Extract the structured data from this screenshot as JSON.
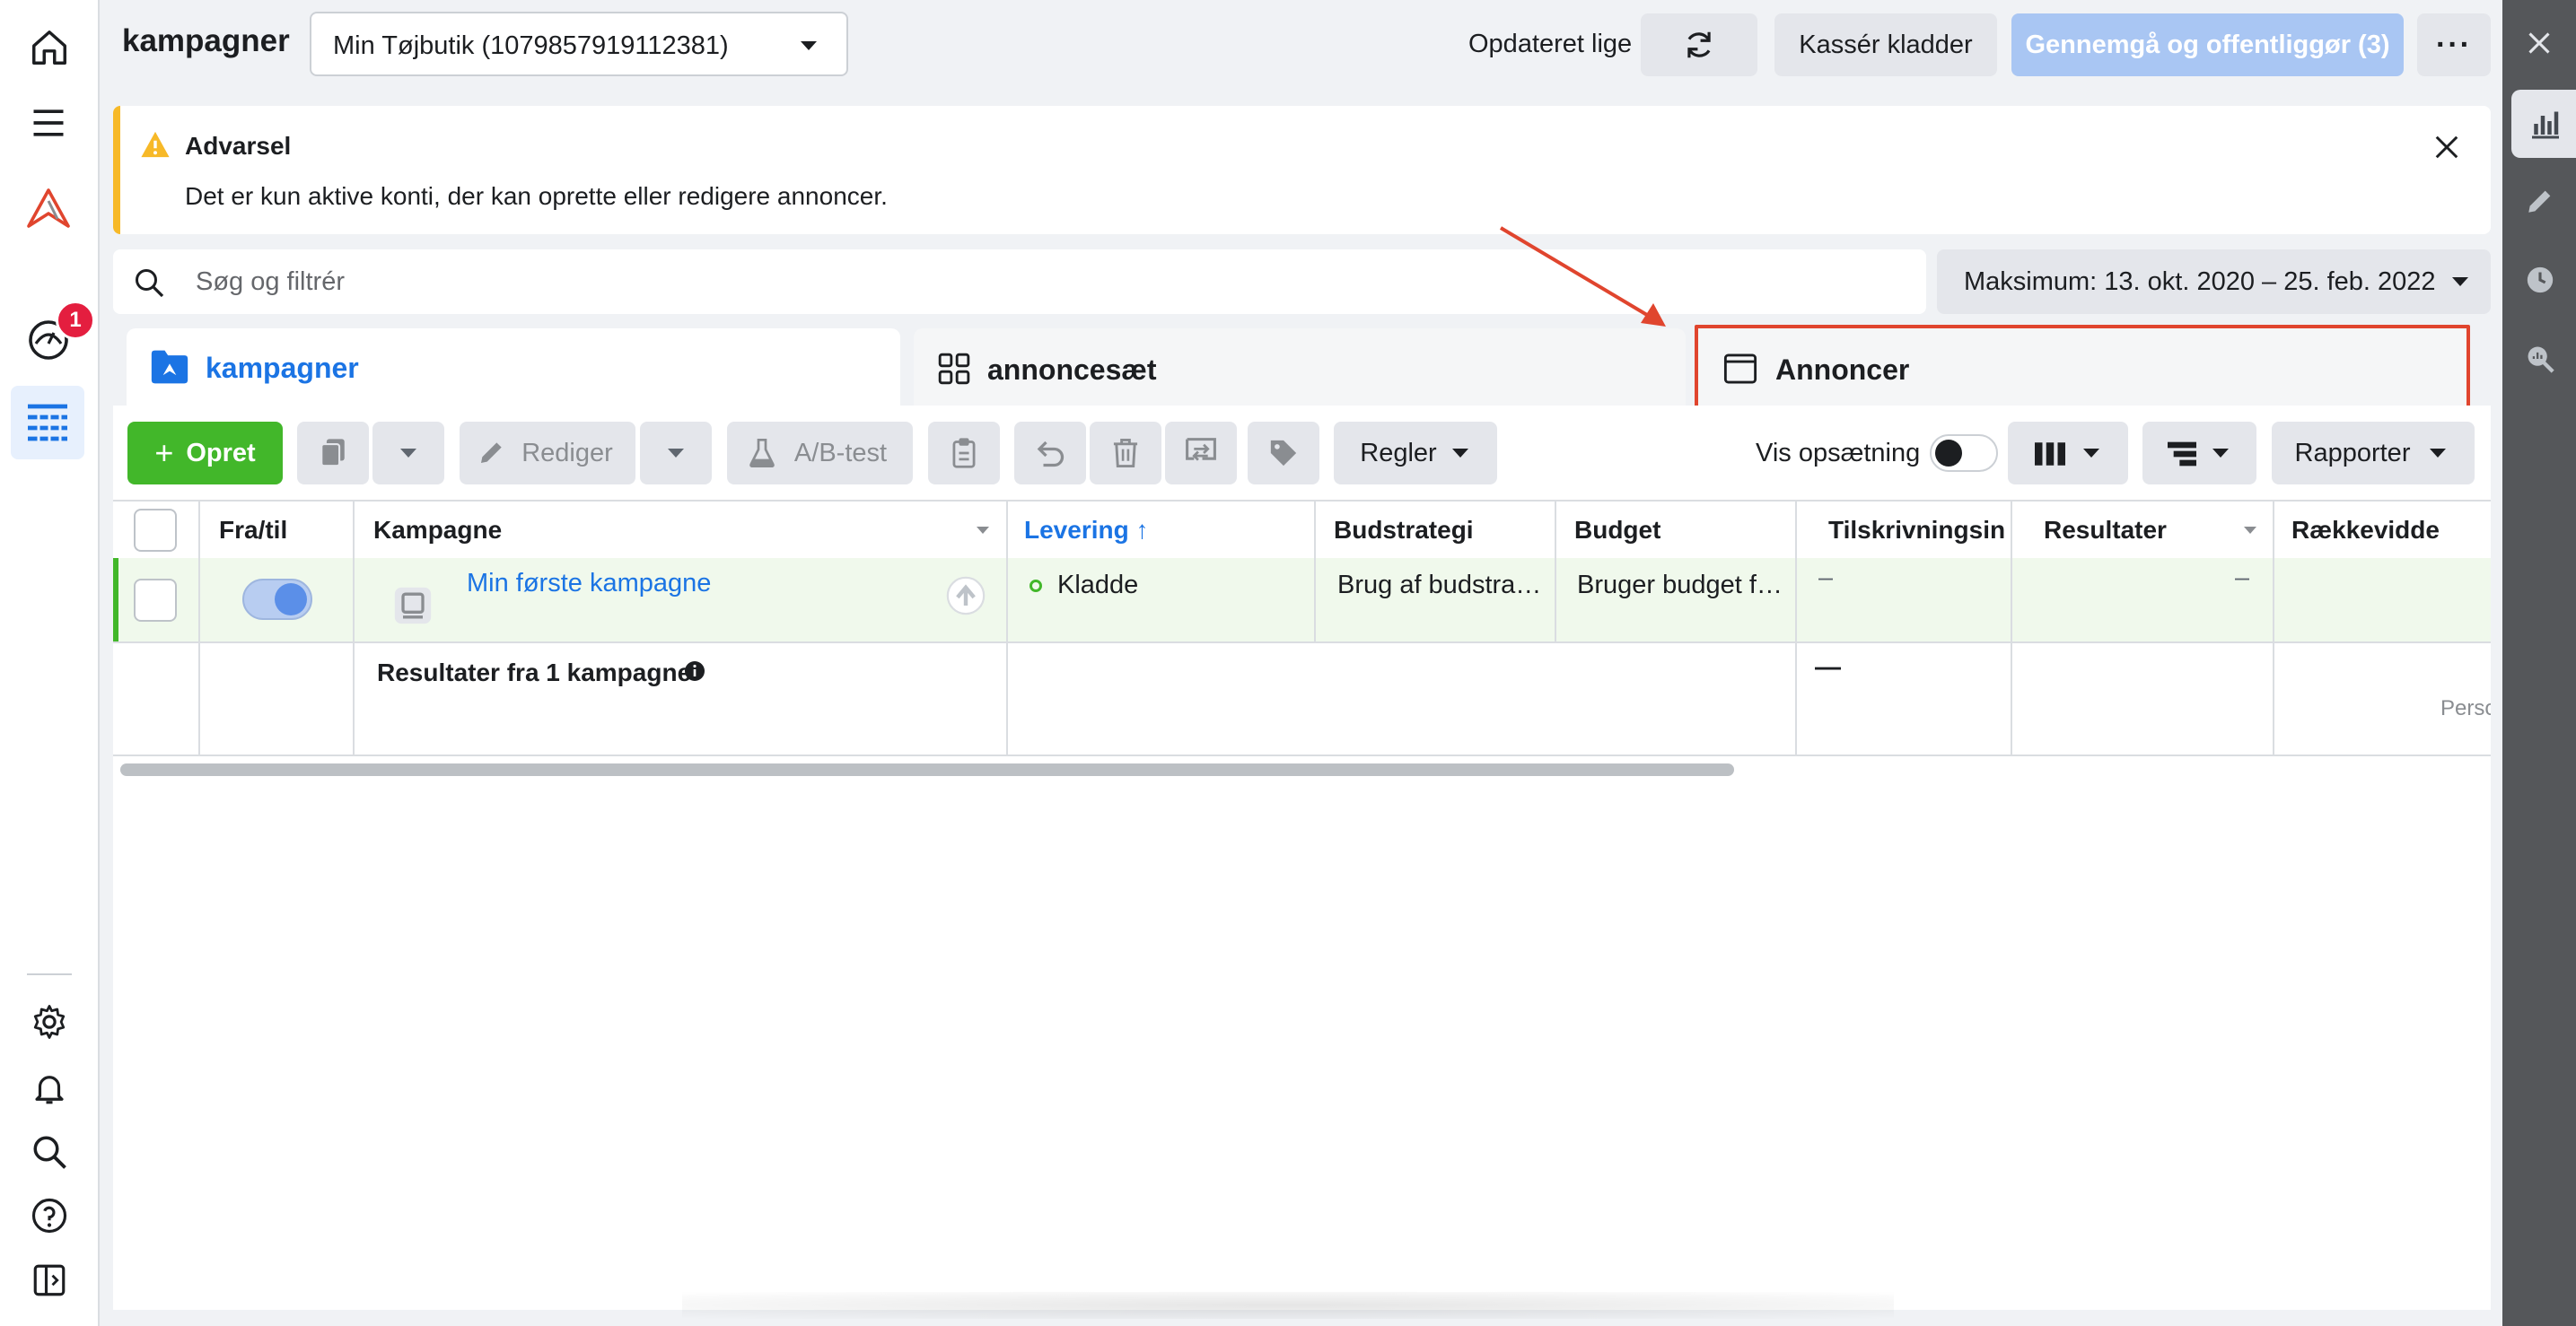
{
  "leftnav": {
    "notification_count": "1"
  },
  "header": {
    "title": "kampagner",
    "account": "Min Tøjbutik (1079857919112381)",
    "updated": "Opdateret lige nu",
    "discard": "Kassér kladder",
    "publish": "Gennemgå og offentliggør (3)"
  },
  "warning": {
    "title": "Advarsel",
    "text": "Det er kun aktive konti, der kan oprette eller redigere annoncer."
  },
  "search": {
    "placeholder": "Søg og filtrér"
  },
  "date_range": "Maksimum: 13. okt. 2020 – 25. feb. 2022",
  "tabs": [
    {
      "label": "kampagner"
    },
    {
      "label": "annoncesæt"
    },
    {
      "label": "Annoncer"
    }
  ],
  "toolbar": {
    "create": "Opret",
    "edit": "Rediger",
    "ab_test": "A/B-test",
    "rules": "Regler",
    "view_setup": "Vis opsætning",
    "reports": "Rapporter"
  },
  "table": {
    "headers": [
      "Fra/til",
      "Kampagne",
      "Levering",
      "Budstrategi",
      "Budget",
      "Tilskrivningsindstilling",
      "Resultater",
      "Rækkevidde"
    ],
    "sort_indicator": "↑",
    "rows": [
      {
        "campaign": "Min første kampagne",
        "delivery": "Kladde",
        "bid_strategy": "Brug af budstra…",
        "budget": "Bruger budget f…",
        "attribution": "–",
        "results": "–",
        "toggle_on": true
      }
    ],
    "summary": {
      "label": "Resultater fra 1 kampagne",
      "attribution": "—",
      "reach_note": "Perso"
    }
  },
  "colors": {
    "accent": "#1b74e4",
    "create": "#42b72a",
    "warning": "#f7b928",
    "highlight": "#e0452e",
    "publish_disabled": "#a9c6f3",
    "notification": "#e41e3f"
  }
}
